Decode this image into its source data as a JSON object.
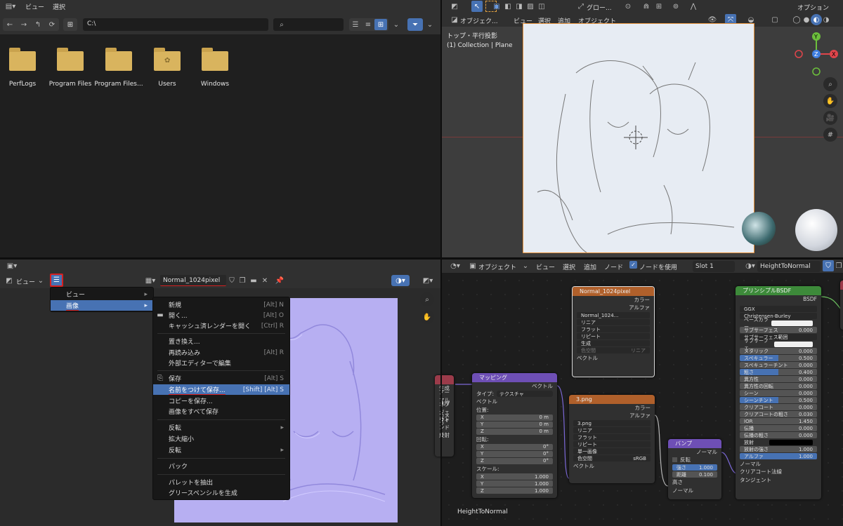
{
  "file_browser": {
    "menu": [
      "ビュー",
      "選択"
    ],
    "path": "C:\\",
    "search_placeholder": "",
    "folders": [
      "PerfLogs",
      "Program Files",
      "Program Files...",
      "Users",
      "Windows"
    ]
  },
  "viewport": {
    "header": {
      "mode": "オブジェク...",
      "menus": [
        "ビュー",
        "選択",
        "追加",
        "オブジェクト"
      ],
      "transform": "グロー...",
      "options": "オプション"
    },
    "overlay_text": [
      "トップ・平行投影",
      "(1) Collection | Plane"
    ],
    "gizmo_axes": [
      "Y",
      "X",
      "Z"
    ]
  },
  "image_editor": {
    "view_label": "ビュー",
    "image_name": "Normal_1024pixel",
    "menu_main": [
      {
        "label": "ビュー"
      },
      {
        "label": "画像"
      }
    ],
    "menu_sub": [
      {
        "label": "新規",
        "shortcut": "[Alt] N"
      },
      {
        "label": "開く...",
        "shortcut": "[Alt] O"
      },
      {
        "label": "キャッシュ済レンダーを開く",
        "shortcut": "[Ctrl] R"
      },
      {
        "label": "置き換え...",
        "shortcut": ""
      },
      {
        "label": "再読み込み",
        "shortcut": "[Alt] R"
      },
      {
        "label": "外部エディターで編集",
        "shortcut": ""
      },
      {
        "label": "保存",
        "shortcut": "[Alt] S"
      },
      {
        "label": "名前をつけて保存...",
        "shortcut": "[Shift] [Alt] S"
      },
      {
        "label": "コピーを保存...",
        "shortcut": ""
      },
      {
        "label": "画像をすべて保存",
        "shortcut": ""
      },
      {
        "label": "反転",
        "shortcut": ""
      },
      {
        "label": "拡大縮小",
        "shortcut": ""
      },
      {
        "label": "反転",
        "shortcut": ""
      },
      {
        "label": "パック",
        "shortcut": ""
      },
      {
        "label": "パレットを抽出",
        "shortcut": ""
      },
      {
        "label": "グリースペンシルを生成",
        "shortcut": ""
      }
    ]
  },
  "node_editor": {
    "header": {
      "mode": "オブジェクト",
      "menus": [
        "ビュー",
        "選択",
        "追加",
        "ノード"
      ],
      "use_nodes": "ノードを使用",
      "slot": "Slot 1",
      "material": "HeightToNormal"
    },
    "material_label": "HeightToNormal",
    "left_node_labels": [
      "生成",
      "ノーマル",
      "UV",
      "オブジェクト",
      "カメラ",
      "ウィンドウ",
      "反射"
    ],
    "image_node_1": {
      "title": "Normal_1024pixel",
      "outputs": [
        "カラー",
        "アルファ"
      ],
      "image": "Normal_1024...",
      "fields": [
        "リニア",
        "フラット",
        "リピート",
        "生成"
      ],
      "colorspace_label": "色空間",
      "colorspace_value": "リニア",
      "input": "ベクトル"
    },
    "mapping_node": {
      "title": "マッピング",
      "output": "ベクトル",
      "type_label": "タイプ:",
      "type_value": "テクスチャ",
      "vector": "ベクトル",
      "location_label": "位置:",
      "location": [
        {
          "axis": "X",
          "value": "0 m"
        },
        {
          "axis": "Y",
          "value": "0 m"
        },
        {
          "axis": "Z",
          "value": "0 m"
        }
      ],
      "rotation_label": "回転:",
      "rotation": [
        {
          "axis": "X",
          "value": "0°"
        },
        {
          "axis": "Y",
          "value": "0°"
        },
        {
          "axis": "Z",
          "value": "0°"
        }
      ],
      "scale_label": "スケール:",
      "scale": [
        {
          "axis": "X",
          "value": "1.000"
        },
        {
          "axis": "Y",
          "value": "1.000"
        },
        {
          "axis": "Z",
          "value": "1.000"
        }
      ]
    },
    "image_node_2": {
      "title": "3.png",
      "outputs": [
        "カラー",
        "アルファ"
      ],
      "image": "3.png",
      "fields": [
        "リニア",
        "フラット",
        "リピート",
        "単一画像"
      ],
      "colorspace_label": "色空間",
      "colorspace_value": "sRGB",
      "input": "ベクトル"
    },
    "bump_node": {
      "title": "バンプ",
      "output": "ノーマル",
      "invert": "反転",
      "strength_label": "強さ",
      "strength": "1.000",
      "distance_label": "距離",
      "distance": "0.100",
      "inputs": [
        "高さ",
        "ノーマル"
      ]
    },
    "bsdf_node": {
      "title": "プリンシプルBSDF",
      "output": "BSDF",
      "dist": "GGX",
      "sss_method": "Christensen-Burley",
      "rows": [
        {
          "label": "ベースカラー",
          "value": "",
          "kind": "color"
        },
        {
          "label": "サブサーフェス",
          "value": "0.000"
        },
        {
          "label": "サブサーフェス範囲",
          "value": "",
          "kind": "dd"
        },
        {
          "label": "サブサーフェ...",
          "value": "",
          "kind": "color"
        },
        {
          "label": "メタリック",
          "value": "0.000"
        },
        {
          "label": "スペキュラー",
          "value": "0.500",
          "kind": "blue"
        },
        {
          "label": "スペキュラーチント",
          "value": "0.000"
        },
        {
          "label": "粗さ",
          "value": "0.400",
          "kind": "blue"
        },
        {
          "label": "異方性",
          "value": "0.000"
        },
        {
          "label": "異方性の回転",
          "value": "0.000"
        },
        {
          "label": "シーン",
          "value": "0.000"
        },
        {
          "label": "シーンチント",
          "value": "0.500",
          "kind": "blue"
        },
        {
          "label": "クリアコート",
          "value": "0.000"
        },
        {
          "label": "クリアコートの粗さ",
          "value": "0.030"
        },
        {
          "label": "IOR",
          "value": "1.450"
        },
        {
          "label": "伝播",
          "value": "0.000"
        },
        {
          "label": "伝播の粗さ",
          "value": "0.000"
        },
        {
          "label": "放射",
          "value": "",
          "kind": "black"
        },
        {
          "label": "放射の強さ",
          "value": "1.000"
        },
        {
          "label": "アルファ",
          "value": "1.000",
          "kind": "fullblue"
        }
      ],
      "inputs": [
        "ノーマル",
        "クリアコート法線",
        "タンジェント"
      ]
    }
  }
}
